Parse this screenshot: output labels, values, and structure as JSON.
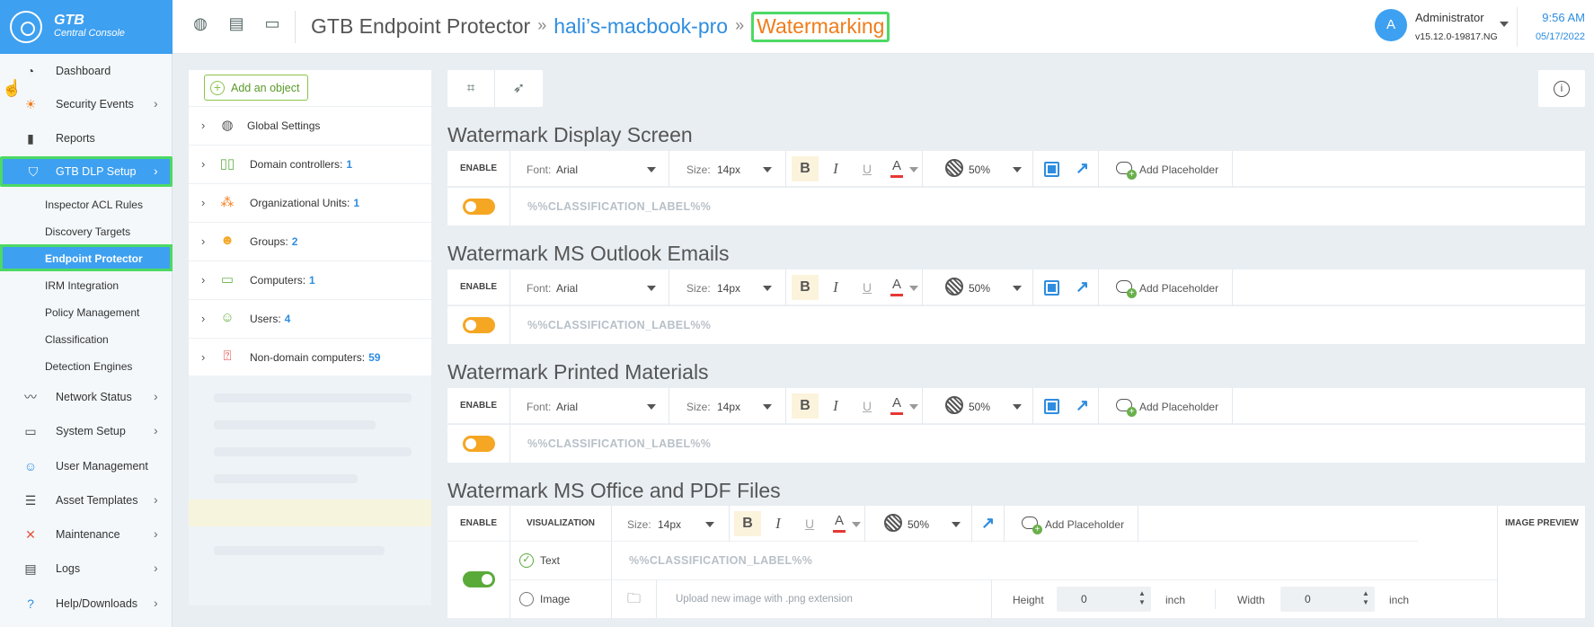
{
  "app": {
    "name_line1": "GTB",
    "name_line2": "Central Console"
  },
  "sidebar": {
    "items": [
      {
        "label": "Dashboard",
        "icon": "gauge-icon"
      },
      {
        "label": "Security Events",
        "icon": "alarm-icon"
      },
      {
        "label": "Reports",
        "icon": "bar-chart-icon"
      },
      {
        "label": "GTB DLP Setup",
        "icon": "shield-icon"
      },
      {
        "label": "Network Status",
        "icon": "pulse-icon"
      },
      {
        "label": "System Setup",
        "icon": "monitor-gear-icon"
      },
      {
        "label": "User Management",
        "icon": "users-icon"
      },
      {
        "label": "Asset Templates",
        "icon": "list-edit-icon"
      },
      {
        "label": "Maintenance",
        "icon": "tools-icon"
      },
      {
        "label": "Logs",
        "icon": "clipboard-icon"
      },
      {
        "label": "Help/Downloads",
        "icon": "help-icon"
      }
    ],
    "subitems": [
      "Inspector ACL Rules",
      "Discovery Targets",
      "Endpoint Protector",
      "IRM Integration",
      "Policy Management",
      "Classification",
      "Detection Engines"
    ]
  },
  "header": {
    "crumb1": "GTB Endpoint Protector",
    "crumb2": "hali’s-macbook-pro",
    "crumb3": "Watermarking",
    "sep": "»",
    "avatar": "A",
    "user": "Administrator",
    "version": "v15.12.0-19817.NG",
    "time": "9:56 AM",
    "date": "05/17/2022"
  },
  "tree": {
    "add_label": "Add an object",
    "rows": [
      {
        "label": "Global Settings",
        "count": ""
      },
      {
        "label": "Domain controllers:",
        "count": "1"
      },
      {
        "label": "Organizational Units:",
        "count": "1"
      },
      {
        "label": "Groups:",
        "count": "2"
      },
      {
        "label": "Computers:",
        "count": "1"
      },
      {
        "label": "Users:",
        "count": "4"
      },
      {
        "label": "Non-domain computers:",
        "count": "59"
      }
    ]
  },
  "toolbar_common": {
    "enable": "ENABLE",
    "font_key": "Font:",
    "font_val": "Arial",
    "size_key": "Size:",
    "size_val": "14px",
    "bold": "B",
    "italic": "I",
    "underline": "U",
    "color": "A",
    "opacity": "50%",
    "add_placeholder": "Add Placeholder",
    "placeholder": "%%CLASSIFICATION_LABEL%%"
  },
  "sections": [
    {
      "title": "Watermark Display Screen",
      "enabled": false
    },
    {
      "title": "Watermark MS Outlook Emails",
      "enabled": false
    },
    {
      "title": "Watermark Printed Materials",
      "enabled": false
    },
    {
      "title": "Watermark MS Office and PDF Files",
      "enabled": true
    }
  ],
  "office": {
    "visualization": "VISUALIZATION",
    "image_preview": "IMAGE PREVIEW",
    "text_opt": "Text",
    "image_opt": "Image",
    "upload_placeholder": "Upload new image with .png extension",
    "height_label": "Height",
    "height_val": "0",
    "width_label": "Width",
    "width_val": "0",
    "unit": "inch"
  }
}
